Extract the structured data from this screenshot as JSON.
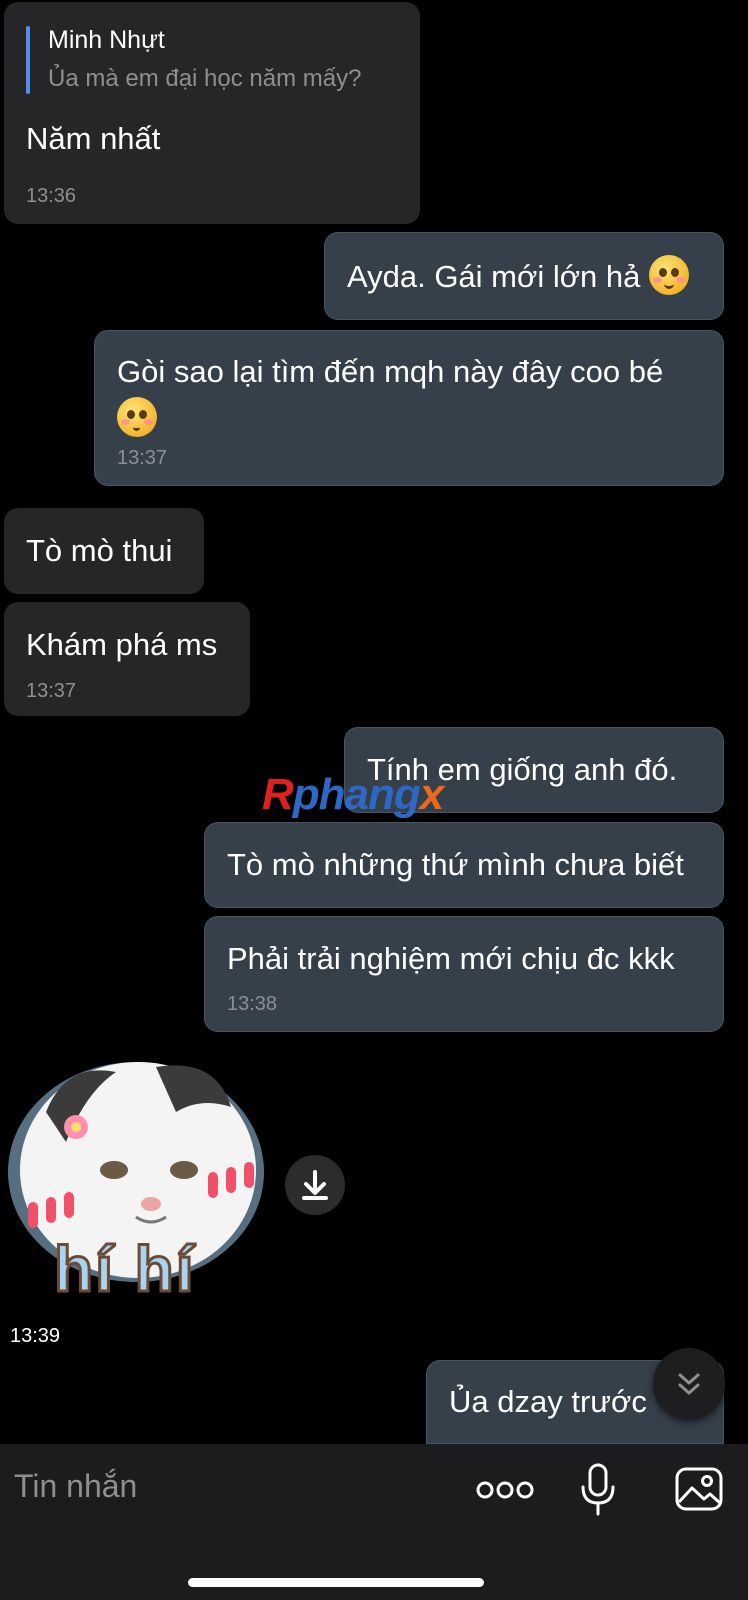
{
  "messages": [
    {
      "reply_name": "Minh Nhựt",
      "reply_text": "Ủa mà em đại học năm mấy?",
      "text": "Năm nhất",
      "time": "13:36"
    },
    {
      "text": "Ayda. Gái mới lớn hả"
    },
    {
      "text_line1": "Gòi sao lại tìm đến mqh này đây coo bé",
      "time": "13:37"
    },
    {
      "text": "Tò mò thui"
    },
    {
      "text": "Khám phá ms",
      "time": "13:37"
    },
    {
      "text": "Tính em giống anh đó."
    },
    {
      "text": "Tò mò những thứ mình chưa biết"
    },
    {
      "text": "Phải trải nghiệm mới chịu đc kkk",
      "time": "13:38"
    },
    {
      "sticker_text": "hí hí",
      "time": "13:39"
    },
    {
      "text": "Ủa dzay trước"
    }
  ],
  "watermark": {
    "part1": "R",
    "part2": "phang",
    "part3": "x"
  },
  "input": {
    "placeholder": "Tin nhắn"
  },
  "icons": {
    "more": "more-dots-icon",
    "mic": "microphone-icon",
    "image": "image-icon",
    "download": "download-icon",
    "scroll": "chevron-double-down-icon"
  }
}
